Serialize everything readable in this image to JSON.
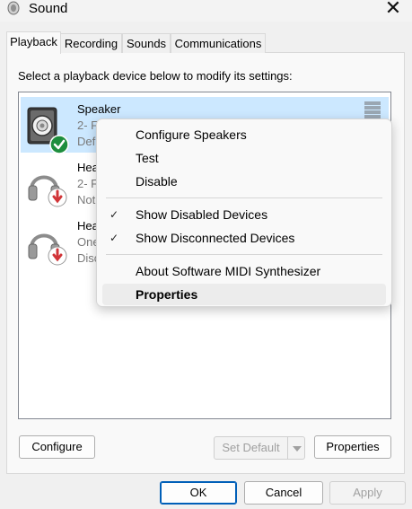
{
  "window": {
    "title": "Sound"
  },
  "tabs": [
    "Playback",
    "Recording",
    "Sounds",
    "Communications"
  ],
  "instruction": "Select a playback device below to modify its settings:",
  "devices": [
    {
      "name": "Speaker",
      "line1": "2- F",
      "line2": "Def",
      "status": "default",
      "icon": "speaker-icon"
    },
    {
      "name": "Hea",
      "line1": "2- F",
      "line2": "Not",
      "status": "disconnected",
      "icon": "headphones-icon"
    },
    {
      "name": "Hea",
      "line1": "One",
      "line2": "Disc",
      "status": "disconnected",
      "icon": "headphones-icon"
    }
  ],
  "context_menu": {
    "items": [
      {
        "label": "Configure Speakers",
        "checked": false
      },
      {
        "label": "Test",
        "checked": false
      },
      {
        "label": "Disable",
        "checked": false
      },
      {
        "label": "Show Disabled Devices",
        "checked": true
      },
      {
        "label": "Show Disconnected Devices",
        "checked": true
      },
      {
        "label": "About Software MIDI Synthesizer",
        "checked": false
      },
      {
        "label": "Properties",
        "checked": false,
        "bold": true,
        "highlighted": true
      }
    ],
    "check_glyph": "✓"
  },
  "buttons": {
    "configure": "Configure",
    "set_default": "Set Default",
    "properties": "Properties",
    "ok": "OK",
    "cancel": "Cancel",
    "apply": "Apply"
  },
  "colors": {
    "selected_row": "#cce8ff",
    "default_badge": "#1e8e3e",
    "disconnected_badge": "#d13438",
    "primary_border": "#005fb8"
  }
}
